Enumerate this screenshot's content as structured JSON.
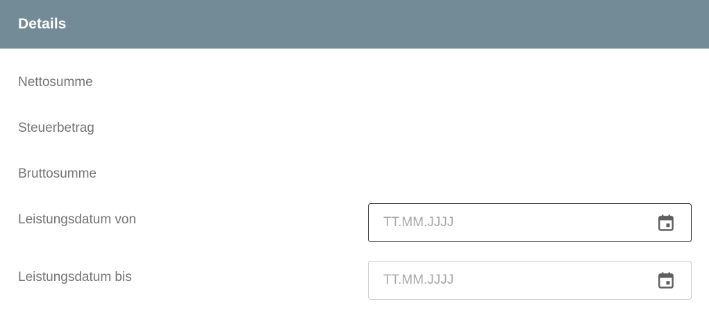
{
  "header": {
    "title": "Details",
    "background": "#738a97"
  },
  "fields": {
    "net_total_label": "Nettosumme",
    "tax_amount_label": "Steuerbetrag",
    "gross_total_label": "Bruttosumme",
    "service_date_from": {
      "label": "Leistungsdatum von",
      "value": "",
      "placeholder": "TT.MM.JJJJ",
      "icon": "calendar-icon"
    },
    "service_date_to": {
      "label": "Leistungsdatum bis",
      "value": "",
      "placeholder": "TT.MM.JJJJ",
      "icon": "calendar-icon"
    }
  },
  "colors": {
    "label_text": "#737373",
    "placeholder_text": "#a9a9a9",
    "focused_border": "#2b2b2b",
    "idle_border": "#c9c9c9"
  }
}
